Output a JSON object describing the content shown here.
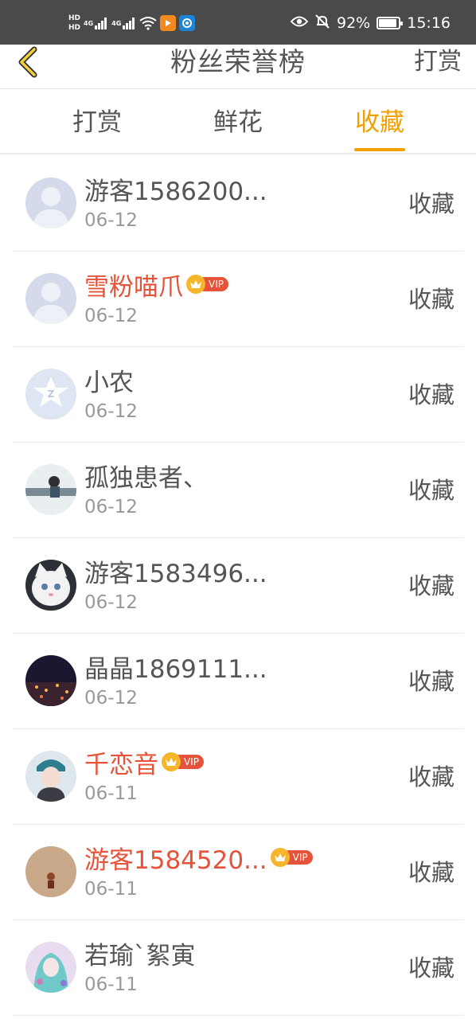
{
  "status_bar": {
    "left_badges": [
      "HD",
      "HD"
    ],
    "network_labels": [
      "4G",
      "4G"
    ],
    "battery_percent_text": "92%",
    "battery_level": 0.92,
    "time": "15:16"
  },
  "navbar": {
    "title": "粉丝荣誉榜",
    "action_label": "打赏"
  },
  "tabs": [
    {
      "label": "打赏",
      "active": false
    },
    {
      "label": "鲜花",
      "active": false
    },
    {
      "label": "收藏",
      "active": true
    }
  ],
  "vip_label": "VIP",
  "rows": [
    {
      "name": "游客1586200...",
      "date": "06-12",
      "action": "收藏",
      "vip": false,
      "avatar": "default"
    },
    {
      "name": "雪粉喵爪",
      "date": "06-12",
      "action": "收藏",
      "vip": true,
      "avatar": "default"
    },
    {
      "name": "小农",
      "date": "06-12",
      "action": "收藏",
      "vip": false,
      "avatar": "qq"
    },
    {
      "name": "孤独患者、",
      "date": "06-12",
      "action": "收藏",
      "vip": false,
      "avatar": "photo-girl"
    },
    {
      "name": "游客1583496...",
      "date": "06-12",
      "action": "收藏",
      "vip": false,
      "avatar": "photo-cat"
    },
    {
      "name": "晶晶1869111...",
      "date": "06-12",
      "action": "收藏",
      "vip": false,
      "avatar": "photo-city"
    },
    {
      "name": "千恋音",
      "date": "06-11",
      "action": "收藏",
      "vip": true,
      "avatar": "photo-portrait"
    },
    {
      "name": "游客1584520...",
      "date": "06-11",
      "action": "收藏",
      "vip": true,
      "avatar": "photo-figure"
    },
    {
      "name": "若瑜`絮寅",
      "date": "06-11",
      "action": "收藏",
      "vip": false,
      "avatar": "photo-anime"
    }
  ],
  "colors": {
    "accent": "#f0a000",
    "vip_name": "#e5533a",
    "status_bar_bg": "#4a4a4a",
    "text": "#555555",
    "secondary_text": "#999999"
  }
}
